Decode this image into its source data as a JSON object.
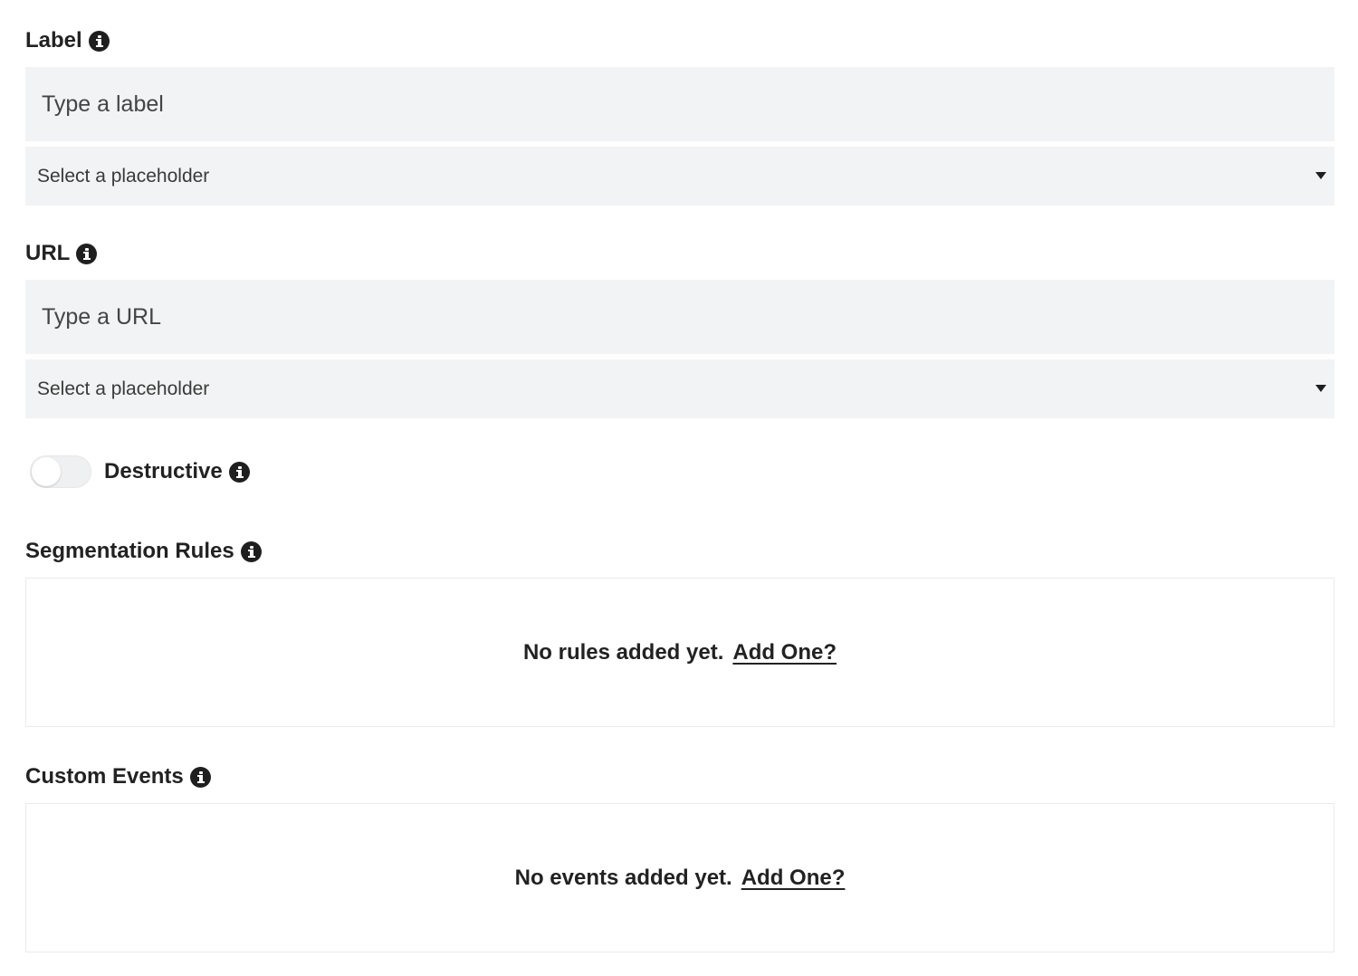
{
  "label_section": {
    "title": "Label",
    "input_placeholder": "Type a label",
    "select_value": "Select a placeholder"
  },
  "url_section": {
    "title": "URL",
    "input_placeholder": "Type a URL",
    "select_value": "Select a placeholder"
  },
  "destructive": {
    "label": "Destructive",
    "enabled": false
  },
  "segmentation_rules": {
    "title": "Segmentation Rules",
    "empty_text": "No rules added yet.",
    "add_link": "Add One?"
  },
  "custom_events": {
    "title": "Custom Events",
    "empty_text": "No events added yet.",
    "add_link": "Add One?"
  },
  "icons": {
    "info": "info-icon",
    "caret": "caret-down-icon"
  },
  "colors": {
    "field_bg": "#f2f3f4",
    "text": "#222222",
    "border": "#e9eaeb"
  }
}
